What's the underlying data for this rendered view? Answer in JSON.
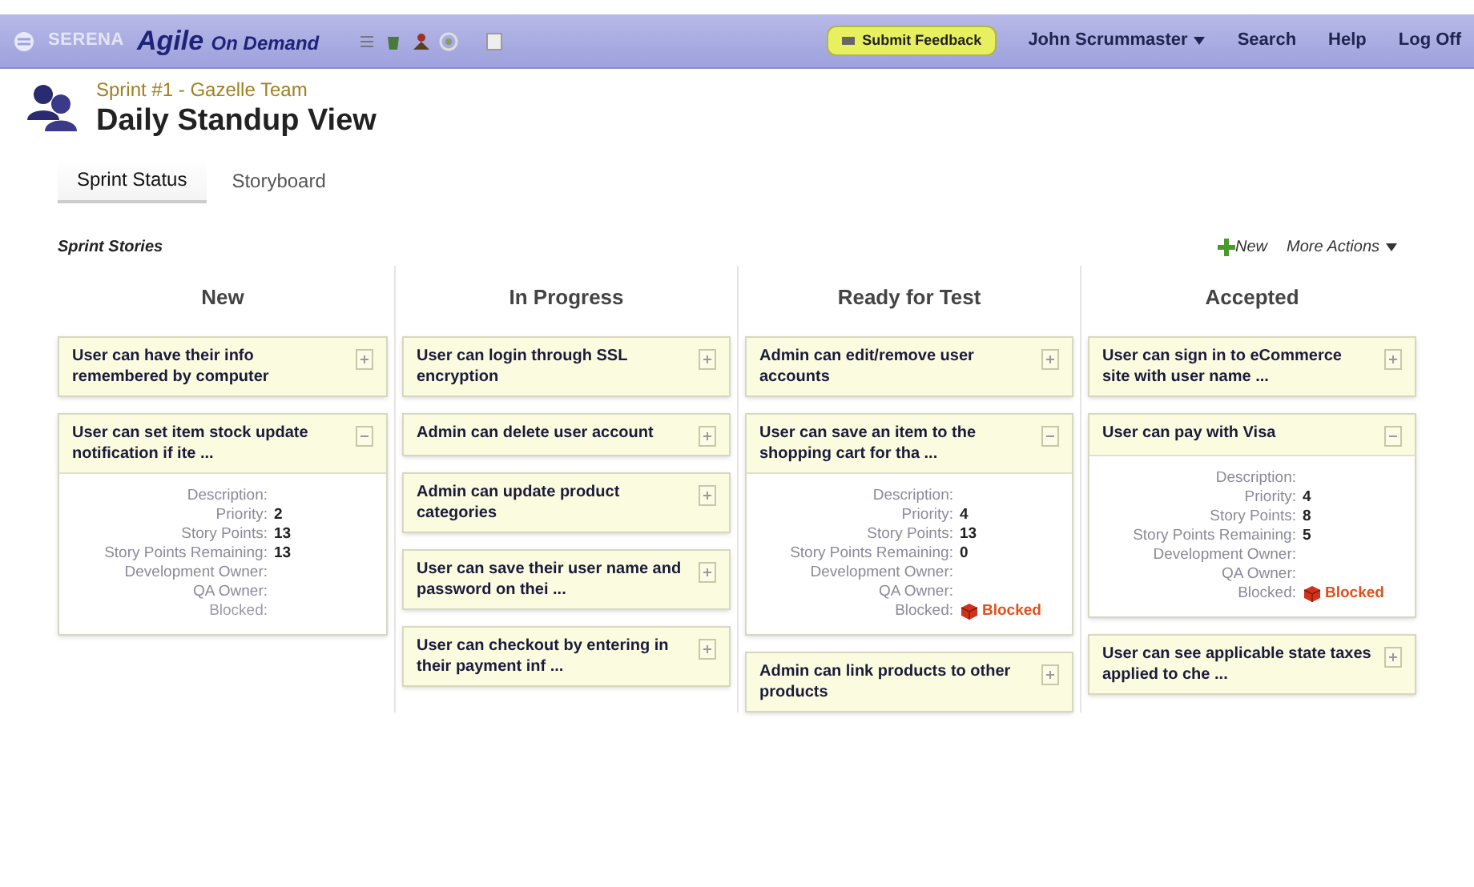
{
  "header": {
    "brand": "SERENA",
    "product": "Agile",
    "product_suffix": "On Demand",
    "feedback": "Submit Feedback",
    "user": "John Scrummaster",
    "links": [
      "Search",
      "Help",
      "Log Off"
    ]
  },
  "page": {
    "subtitle": "Sprint #1 - Gazelle Team",
    "title": "Daily Standup View"
  },
  "tabs": [
    {
      "label": "Sprint Status",
      "selected": true
    },
    {
      "label": "Storyboard",
      "selected": false
    }
  ],
  "section": {
    "title": "Sprint Stories",
    "new": "New",
    "more": "More Actions"
  },
  "columns": [
    {
      "title": "New",
      "cards": [
        {
          "title": "User can have their info remembered by computer",
          "expanded": false
        },
        {
          "title": "User can set item stock update notification if ite ...",
          "expanded": true,
          "details": [
            {
              "label": "Description:"
            },
            {
              "label": "Priority:",
              "value": "2"
            },
            {
              "label": "Story Points:",
              "value": "13"
            },
            {
              "label": "Story Points Remaining:",
              "value": "13"
            },
            {
              "label": "Development Owner:"
            },
            {
              "label": "QA Owner:"
            }
          ],
          "blocked_label": "Blocked:",
          "blocked": false
        }
      ]
    },
    {
      "title": "In Progress",
      "cards": [
        {
          "title": "User can login through SSL encryption",
          "expanded": false
        },
        {
          "title": "Admin can delete user account",
          "expanded": false
        },
        {
          "title": "Admin can update product categories",
          "expanded": false
        },
        {
          "title": "User can save their user name and password on thei ...",
          "expanded": false
        },
        {
          "title": "User can checkout by entering in their payment inf ...",
          "expanded": false
        }
      ]
    },
    {
      "title": "Ready for Test",
      "cards": [
        {
          "title": "Admin can edit/remove user accounts",
          "expanded": false
        },
        {
          "title": "User can save an item to the shopping cart for tha ...",
          "expanded": true,
          "details": [
            {
              "label": "Description:"
            },
            {
              "label": "Priority:",
              "value": "4"
            },
            {
              "label": "Story Points:",
              "value": "13"
            },
            {
              "label": "Story Points Remaining:",
              "value": "0"
            },
            {
              "label": "Development Owner:"
            },
            {
              "label": "QA Owner:"
            }
          ],
          "blocked_label": "Blocked:",
          "blocked": true,
          "blocked_text": "Blocked"
        },
        {
          "title": "Admin can link products to other products",
          "expanded": false
        }
      ]
    },
    {
      "title": "Accepted",
      "cards": [
        {
          "title": "User can sign in to eCommerce site with user name ...",
          "expanded": false
        },
        {
          "title": "User can pay with Visa",
          "expanded": true,
          "details": [
            {
              "label": "Description:"
            },
            {
              "label": "Priority:",
              "value": "4"
            },
            {
              "label": "Story Points:",
              "value": "8"
            },
            {
              "label": "Story Points Remaining:",
              "value": "5"
            },
            {
              "label": "Development Owner:"
            },
            {
              "label": "QA Owner:"
            }
          ],
          "blocked_label": "Blocked:",
          "blocked": true,
          "blocked_text": "Blocked"
        },
        {
          "title": "User can see applicable state taxes applied to che ...",
          "expanded": false
        }
      ]
    }
  ]
}
